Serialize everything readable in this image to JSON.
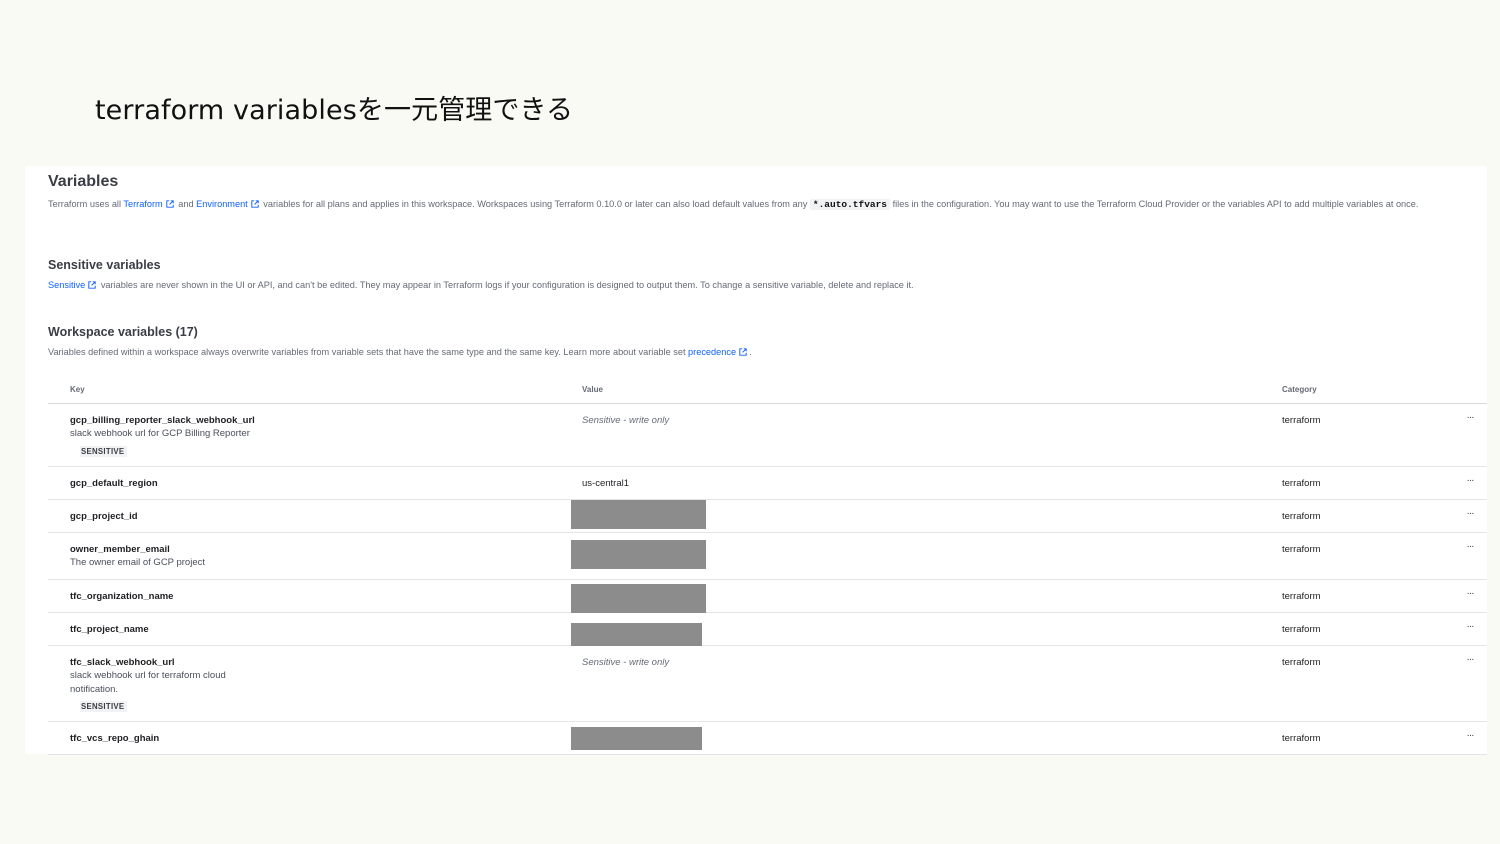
{
  "slide": {
    "title": "terraform variablesを一元管理できる"
  },
  "header": {
    "title": "Variables",
    "desc_1": "Terraform uses all ",
    "link_terraform": "Terraform",
    "desc_2": " and ",
    "link_environment": "Environment",
    "desc_3": " variables for all plans and applies in this workspace. Workspaces using Terraform 0.10.0 or later can also load default values from any ",
    "code": "*.auto.tfvars",
    "desc_4": " files in the configuration. You may want to use the Terraform Cloud Provider or the variables API to add multiple variables at once."
  },
  "sensitive_section": {
    "title": "Sensitive variables",
    "link": "Sensitive",
    "desc": " variables are never shown in the UI or API, and can't be edited. They may appear in Terraform logs if your configuration is designed to output them. To change a sensitive variable, delete and replace it."
  },
  "workspace_section": {
    "title": "Workspace variables (17)",
    "desc_1": "Variables defined within a workspace always overwrite variables from variable sets that have the same type and the same key. Learn more about variable set ",
    "link": "precedence",
    "desc_2": "."
  },
  "table": {
    "headers": {
      "key": "Key",
      "value": "Value",
      "category": "Category"
    },
    "menu_label": "···",
    "rows": [
      {
        "key": "gcp_billing_reporter_slack_webhook_url",
        "desc": "slack webhook url for GCP Billing Reporter",
        "badge": "SENSITIVE",
        "value": "Sensitive - write only",
        "category": "terraform"
      },
      {
        "key": "gcp_default_region",
        "value": "us-central1",
        "category": "terraform"
      },
      {
        "key": "gcp_project_id",
        "value_redacted": true,
        "category": "terraform"
      },
      {
        "key": "owner_member_email",
        "desc": "The owner email of GCP project",
        "value_redacted": true,
        "category": "terraform"
      },
      {
        "key": "tfc_organization_name",
        "value_redacted": true,
        "category": "terraform"
      },
      {
        "key": "tfc_project_name",
        "value_redacted": true,
        "category": "terraform"
      },
      {
        "key": "tfc_slack_webhook_url",
        "desc_line1": "slack webhook url for terraform cloud",
        "desc_line2": "notification.",
        "badge": "SENSITIVE",
        "value": "Sensitive - write only",
        "category": "terraform"
      },
      {
        "key": "tfc_vcs_repo_ghain",
        "value_redacted": true,
        "category": "terraform"
      }
    ]
  },
  "colors": {
    "link": "#1060ff",
    "redaction": "#8c8c8c",
    "background": "#fafaf4"
  }
}
